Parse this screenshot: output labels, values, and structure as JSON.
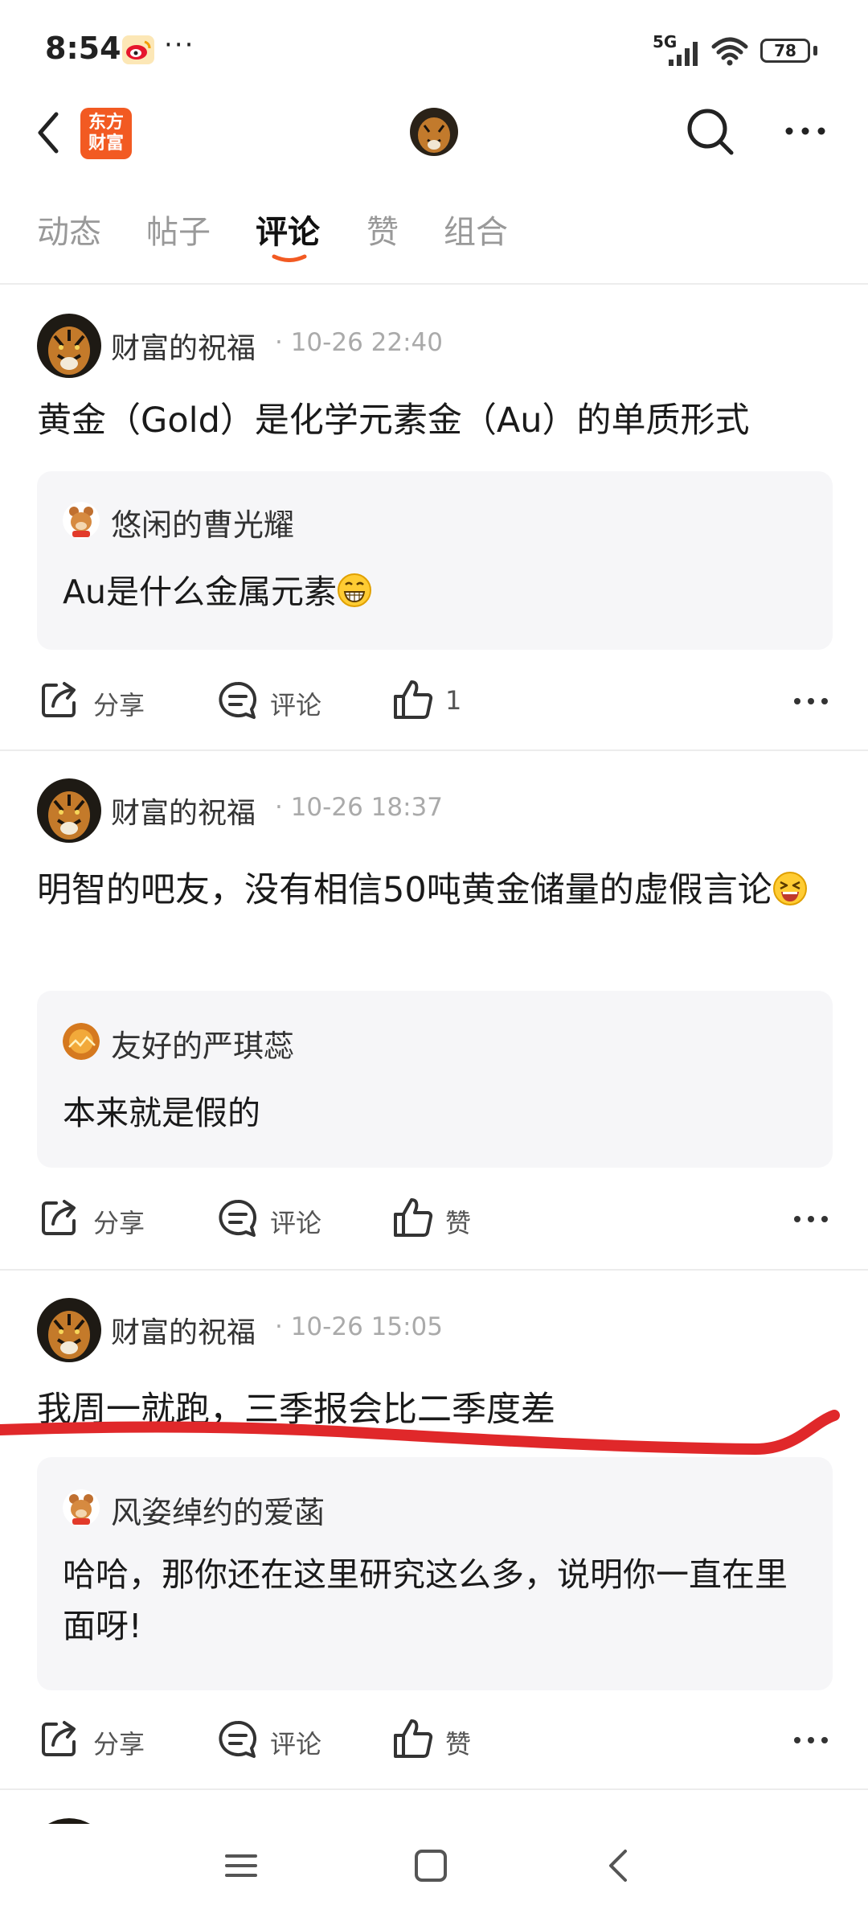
{
  "status_bar": {
    "time": "8:54",
    "dots": "···",
    "network": "5G",
    "battery": "78"
  },
  "header": {
    "brand_logo_text": [
      "东方",
      "财富"
    ],
    "icons": [
      "back-arrow-icon",
      "search-icon",
      "more-icon"
    ]
  },
  "tabs": [
    {
      "label": "动态",
      "active": false
    },
    {
      "label": "帖子",
      "active": false
    },
    {
      "label": "评论",
      "active": true
    },
    {
      "label": "赞",
      "active": false
    },
    {
      "label": "组合",
      "active": false
    }
  ],
  "accent_color": "#f25a22",
  "posts": [
    {
      "author": "财富的祝福",
      "time": "· 10-26 22:40",
      "text": " 黄金（Gold）是化学元素金（Au）的单质形式",
      "quote_author": "悠闲的曹光耀",
      "quote_text": "Au是什么金属元素",
      "quote_emoji": "grin-emoji",
      "actions": {
        "share": "分享",
        "comment": "评论",
        "like": "1"
      }
    },
    {
      "author": "财富的祝福",
      "time": "· 10-26 18:37",
      "text": "明智的吧友，没有相信50吨黄金储量的虚假言论",
      "text_emoji": "laughing-emoji",
      "quote_author": "友好的严琪蕊",
      "quote_text": "本来就是假的",
      "actions": {
        "share": "分享",
        "comment": "评论",
        "like": "赞"
      }
    },
    {
      "author": "财富的祝福",
      "time": "· 10-26 15:05",
      "text": "我周一就跑，三季报会比二季度差",
      "quote_author": "风姿绰约的爱菡",
      "quote_text": "哈哈，那你还在这里研究这么多，说明你一直在里面呀!",
      "actions": {
        "share": "分享",
        "comment": "评论",
        "like": "赞"
      }
    }
  ],
  "annotation": {
    "type": "red-underline-stroke",
    "color": "#e0282a"
  },
  "navbar": {
    "icons": [
      "menu-icon",
      "home-square-icon",
      "back-icon"
    ]
  }
}
